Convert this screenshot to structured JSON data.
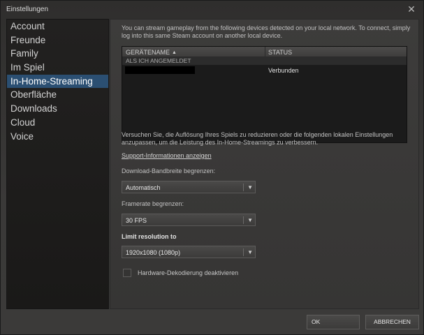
{
  "window": {
    "title": "Einstellungen",
    "close_icon": "close-icon"
  },
  "sidebar": {
    "items": [
      {
        "label": "Account"
      },
      {
        "label": "Freunde"
      },
      {
        "label": "Family"
      },
      {
        "label": "Im Spiel"
      },
      {
        "label": "In-Home-Streaming",
        "active": true
      },
      {
        "label": "Oberfläche"
      },
      {
        "label": "Downloads"
      },
      {
        "label": "Cloud"
      },
      {
        "label": "Voice"
      }
    ],
    "active_color": "#2b4f72"
  },
  "main": {
    "intro": "You can stream gameplay from the following devices detected on your local network. To connect, simply log into this same Steam account on another local device.",
    "table": {
      "columns": [
        "GERÄTENAME",
        "STATUS"
      ],
      "sort_icon": "sort-ascending-icon",
      "group_label": "ALS ICH ANGEMELDET",
      "rows": [
        {
          "name_redacted": true,
          "status": "Verbunden"
        }
      ]
    },
    "hint": "Versuchen Sie, die Auflösung Ihres Spiels zu reduzieren oder die folgenden lokalen Einstellungen anzupassen, um die Leistung des In-Home-Streamings zu verbessern.",
    "support_link": "Support-Informationen anzeigen",
    "bandwidth": {
      "label": "Download-Bandbreite begrenzen:",
      "value": "Automatisch"
    },
    "framerate": {
      "label": "Framerate begrenzen:",
      "value": "30 FPS"
    },
    "resolution": {
      "label": "Limit resolution to",
      "value": "1920x1080 (1080p)"
    },
    "hw_decoding": {
      "label": "Hardware-Dekodierung deaktivieren",
      "checked": false
    }
  },
  "footer": {
    "ok_label": "OK",
    "cancel_label": "ABBRECHEN"
  }
}
